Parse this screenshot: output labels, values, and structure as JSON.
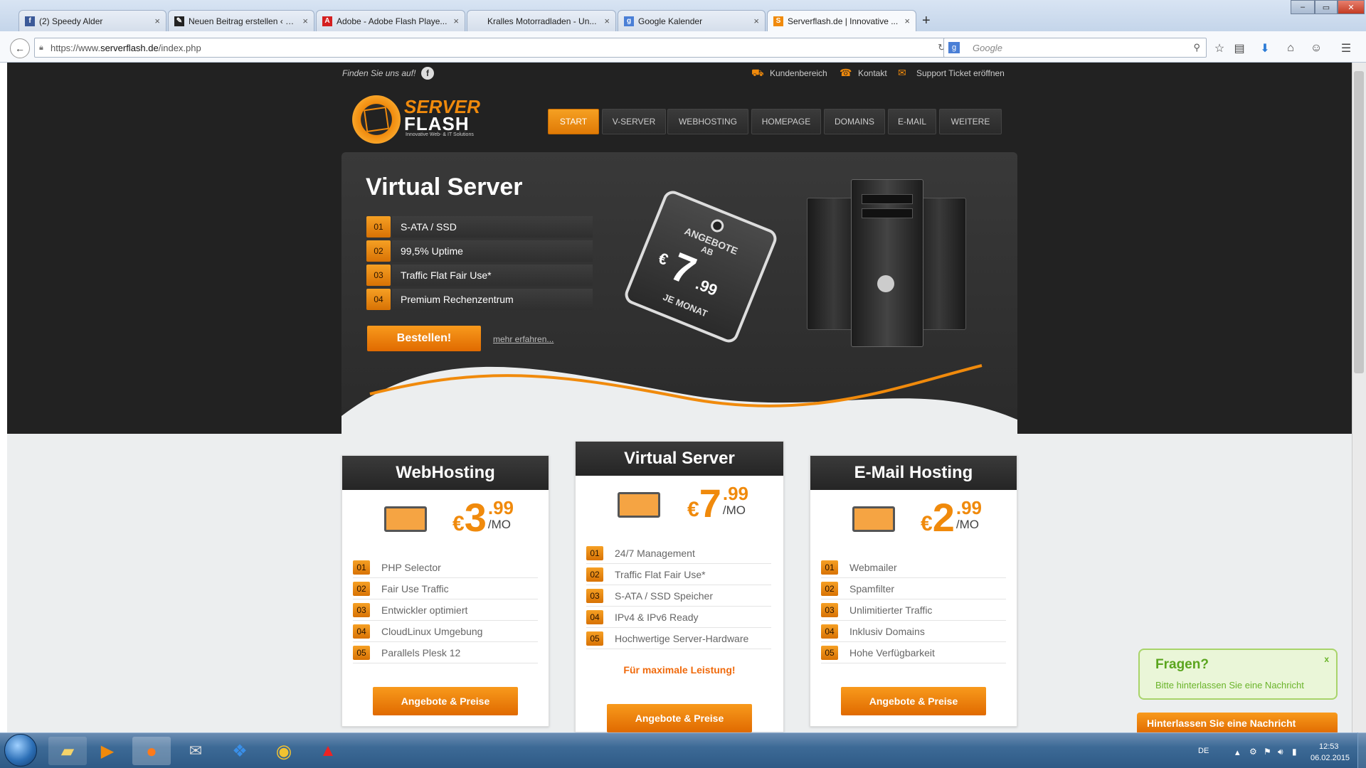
{
  "browser": {
    "tabs": [
      {
        "title": "(2) Speedy Alder",
        "favicon": "facebook-icon",
        "fav_color": "#3b5998",
        "fav_char": "f"
      },
      {
        "title": "Neuen Beitrag erstellen ‹ Bi...",
        "favicon": "blog-icon",
        "fav_color": "#222",
        "fav_char": "✎"
      },
      {
        "title": "Adobe - Adobe Flash Playe...",
        "favicon": "adobe-icon",
        "fav_color": "#d41f1f",
        "fav_char": "A"
      },
      {
        "title": "Kralles Motorradladen - Un...",
        "favicon": "",
        "fav_color": "",
        "fav_char": ""
      },
      {
        "title": "Google Kalender",
        "favicon": "google-icon",
        "fav_color": "#4a7fd6",
        "fav_char": "g"
      },
      {
        "title": "Serverflash.de | Innovative ...",
        "favicon": "serverflash-icon",
        "fav_color": "#f08a0c",
        "fav_char": "S"
      }
    ],
    "url_prefix": "https://www.",
    "url_domain": "serverflash.de",
    "url_path": "/index.php",
    "search_placeholder": "Google"
  },
  "site": {
    "follow_us": "Finden Sie uns auf!",
    "top_links": [
      "Kundenbereich",
      "Kontakt",
      "Support Ticket eröffnen"
    ],
    "logo_line1": "SERVER",
    "logo_line2": "FLASH",
    "logo_tagline": "Innovative Web- & IT Solutions",
    "nav": [
      "START",
      "V-SERVER",
      "WEBHOSTING",
      "HOMEPAGE",
      "DOMAINS",
      "E-MAIL",
      "WEITERE"
    ],
    "active_nav": "START"
  },
  "hero": {
    "title": "Virtual Server",
    "features": [
      {
        "num": "01",
        "label": "S-ATA / SSD"
      },
      {
        "num": "02",
        "label": "99,5% Uptime"
      },
      {
        "num": "03",
        "label": "Traffic Flat Fair Use*"
      },
      {
        "num": "04",
        "label": "Premium Rechenzentrum"
      }
    ],
    "order_button": "Bestellen!",
    "more_link": "mehr erfahren...",
    "tag_top": "ANGEBOTE",
    "tag_sub": "AB",
    "tag_currency": "€",
    "tag_price": "7",
    "tag_cents": ".99",
    "tag_bottom": "JE MONAT"
  },
  "cards": [
    {
      "title": "WebHosting",
      "currency": "€",
      "price": "3",
      "cents": ".99",
      "unit": "/MO",
      "items": [
        {
          "num": "01",
          "label": "PHP Selector"
        },
        {
          "num": "02",
          "label": "Fair Use Traffic"
        },
        {
          "num": "03",
          "label": "Entwickler optimiert"
        },
        {
          "num": "04",
          "label": "CloudLinux Umgebung"
        },
        {
          "num": "05",
          "label": "Parallels Plesk 12"
        }
      ],
      "button": "Angebote & Preise"
    },
    {
      "title": "Virtual Server",
      "currency": "€",
      "price": "7",
      "cents": ".99",
      "unit": "/MO",
      "items": [
        {
          "num": "01",
          "label": "24/7 Management"
        },
        {
          "num": "02",
          "label": "Traffic Flat Fair Use*"
        },
        {
          "num": "03",
          "label": "S-ATA / SSD Speicher"
        },
        {
          "num": "04",
          "label": "IPv4 & IPv6 Ready"
        },
        {
          "num": "05",
          "label": "Hochwertige Server-Hardware"
        }
      ],
      "tagline": "Für maximale Leistung!",
      "button": "Angebote & Preise"
    },
    {
      "title": "E-Mail Hosting",
      "currency": "€",
      "price": "2",
      "cents": ".99",
      "unit": "/MO",
      "items": [
        {
          "num": "01",
          "label": "Webmailer"
        },
        {
          "num": "02",
          "label": "Spamfilter"
        },
        {
          "num": "03",
          "label": "Unlimitierter Traffic"
        },
        {
          "num": "04",
          "label": "Inklusiv Domains"
        },
        {
          "num": "05",
          "label": "Hohe Verfügbarkeit"
        }
      ],
      "button": "Angebote & Preise"
    }
  ],
  "chat": {
    "title": "Fragen?",
    "subtitle": "Bitte hinterlassen Sie eine Nachricht",
    "close": "x",
    "button": "Hinterlassen Sie eine Nachricht"
  },
  "taskbar": {
    "lang": "DE",
    "time": "12:53",
    "date": "06.02.2015"
  },
  "colors": {
    "accent": "#f08a0c",
    "dark": "#222222"
  }
}
